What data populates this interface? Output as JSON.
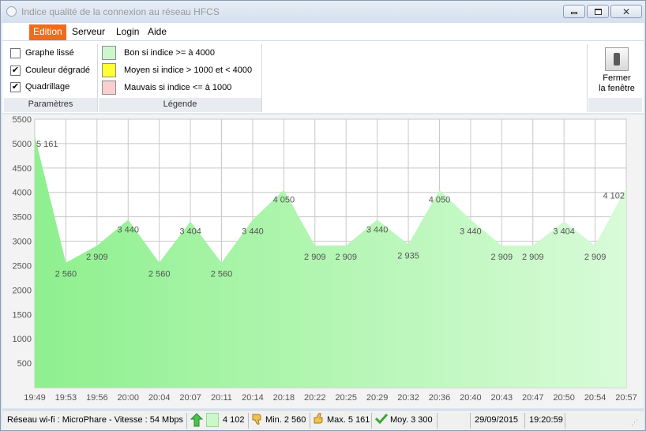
{
  "window": {
    "title": "Indice qualité de la connexion au réseau HFCS"
  },
  "menu": {
    "items": [
      "Edition",
      "Serveur",
      "Login",
      "Aide"
    ],
    "active": "Edition",
    "accent_color": "#f26b1d"
  },
  "params": {
    "group_label": "Paramètres",
    "options": [
      {
        "label": "Graphe lissé",
        "checked": false
      },
      {
        "label": "Couleur dégradé",
        "checked": true
      },
      {
        "label": "Quadrillage",
        "checked": true
      }
    ]
  },
  "legend": {
    "group_label": "Légende",
    "items": [
      {
        "label": "Bon si indice >= à 4000",
        "color": "#ccf7cc"
      },
      {
        "label": "Moyen si indice > 1000 et < 4000",
        "color": "#ffff33"
      },
      {
        "label": "Mauvais si indice <= à 1000",
        "color": "#f9cfcf"
      }
    ]
  },
  "close_tool": {
    "label_line1": "Fermer",
    "label_line2": "la fenêtre",
    "icon": "switch-icon"
  },
  "chart_data": {
    "type": "area",
    "x": [
      "19:49",
      "19:53",
      "19:56",
      "20:00",
      "20:04",
      "20:07",
      "20:11",
      "20:14",
      "20:18",
      "20:22",
      "20:25",
      "20:29",
      "20:32",
      "20:36",
      "20:40",
      "20:43",
      "20:47",
      "20:50",
      "20:54",
      "20:57"
    ],
    "values": [
      5161,
      2560,
      2909,
      3440,
      2560,
      3404,
      2560,
      3440,
      4050,
      2909,
      2909,
      3440,
      2935,
      4050,
      3440,
      2909,
      2909,
      3404,
      2909,
      4102
    ],
    "data_labels": [
      "5 161",
      "2 560",
      "2 909",
      "3 440",
      "2 560",
      "3 404",
      "2 560",
      "3 440",
      "4 050",
      "2 909",
      "2 909",
      "3 440",
      "2 935",
      "4 050",
      "3 440",
      "2 909",
      "2 909",
      "3 404",
      "2 909",
      "4 102"
    ],
    "ylim": [
      0,
      5500
    ],
    "yticks": [
      "500",
      "1000",
      "1500",
      "2000",
      "2500",
      "3000",
      "3500",
      "4000",
      "4500",
      "5000",
      "5500"
    ],
    "grid": true,
    "fill_gradient": [
      "#8ef08e",
      "#d8fbd8"
    ]
  },
  "status": {
    "network": "Réseau wi-fi : MicroPhare  -  Vitesse : 54 Mbps",
    "current": "4 102",
    "min": "Min. 2 560",
    "max": "Max. 5 161",
    "avg": "Moy. 3 300",
    "date": "29/09/2015",
    "time": "19:20:59"
  }
}
